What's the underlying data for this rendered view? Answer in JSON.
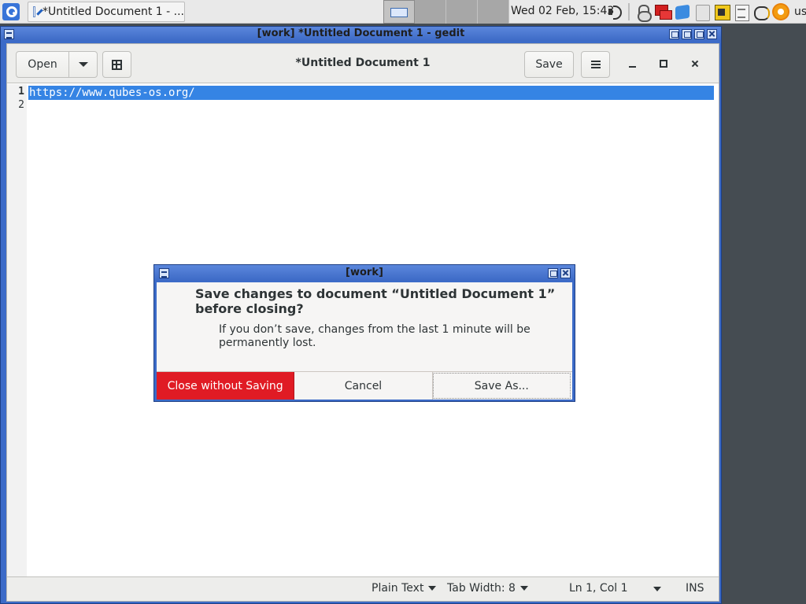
{
  "taskbar": {
    "task_label": "*Untitled Document 1 - ...",
    "clock": "Wed 02 Feb, 15:43",
    "user": "user",
    "workspaces": [
      "1",
      "2",
      "3",
      "4"
    ]
  },
  "window": {
    "wm_title": "[work] *Untitled Document 1 - gedit"
  },
  "headerbar": {
    "open_label": "Open",
    "title": "*Untitled Document 1",
    "save_label": "Save"
  },
  "editor": {
    "line_numbers": [
      "1",
      "2"
    ],
    "lines": [
      "https://www.qubes-os.org/",
      ""
    ]
  },
  "statusbar": {
    "language": "Plain Text",
    "tab_width": "Tab Width: 8",
    "position": "Ln 1, Col 1",
    "mode": "INS"
  },
  "dialog": {
    "wm_title": "[work]",
    "heading": "Save changes to document “Untitled Document 1” before closing?",
    "message": "If you don’t save, changes from the last 1 minute will be permanently lost.",
    "close_without_saving": "Close without Saving",
    "cancel": "Cancel",
    "save_as": "Save As..."
  },
  "colors": {
    "accent": "#3584e4",
    "destructive": "#e01b24",
    "wm_titlebar": "#3d6ac6"
  }
}
